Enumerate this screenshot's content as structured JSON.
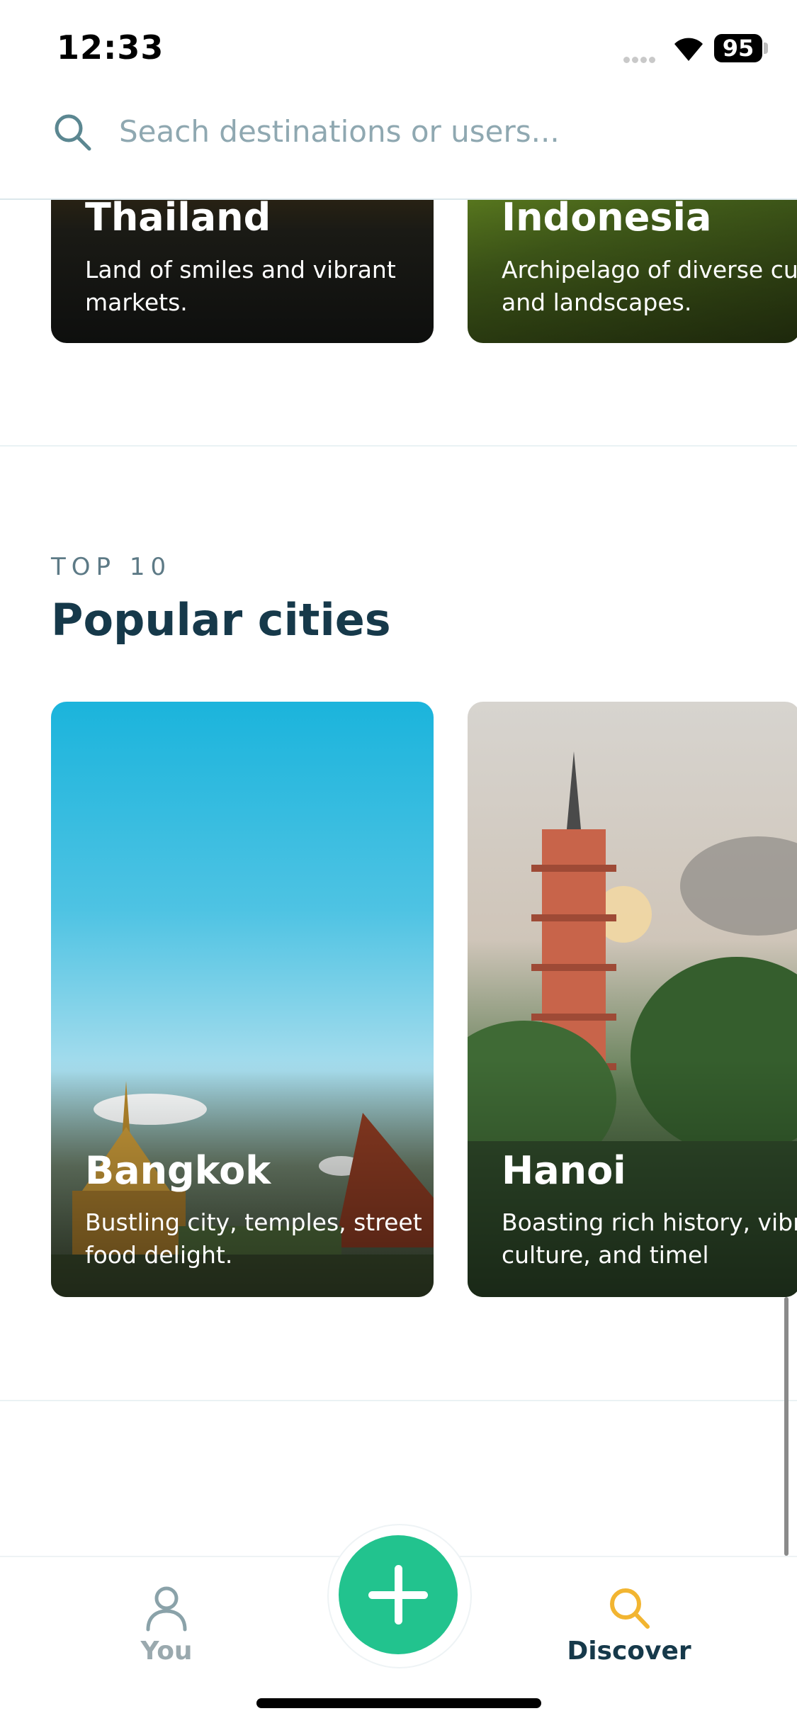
{
  "status": {
    "time": "12:33",
    "battery": "95"
  },
  "search": {
    "placeholder": "Seach destinations or users..."
  },
  "countries": [
    {
      "title": "Thailand",
      "description": "Land of smiles and vibrant markets."
    },
    {
      "title": "Indonesia",
      "description": "Archipelago of diverse cultures and landscapes."
    }
  ],
  "popular": {
    "eyebrow": "TOP 10",
    "title": "Popular cities",
    "cities": [
      {
        "title": "Bangkok",
        "description": "Bustling city, temples, street food delight."
      },
      {
        "title": "Hanoi",
        "description": "Boasting rich history, vibrant culture, and timel"
      }
    ]
  },
  "tabs": {
    "you": "You",
    "discover": "Discover"
  },
  "colors": {
    "accent": "#22c38e",
    "active_tab": "#f2b531",
    "text": "#16394a"
  }
}
